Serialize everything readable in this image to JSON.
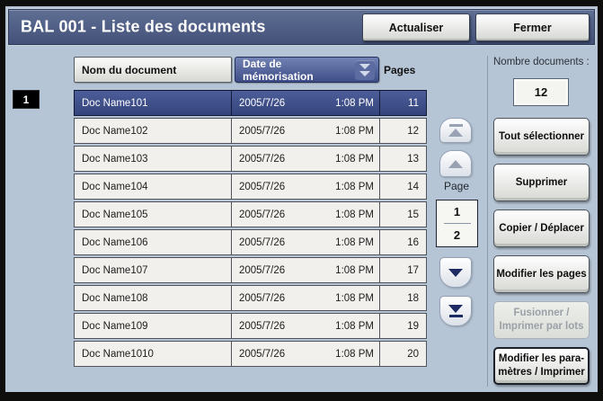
{
  "title_bar": {
    "title": "BAL 001 - Liste des documents",
    "refresh_label": "Actualiser",
    "close_label": "Fermer"
  },
  "table": {
    "columns": {
      "name": "Nom du document",
      "date": "Date de mémorisation",
      "pages": "Pages"
    },
    "sort": {
      "column": "Date de mémorisation",
      "direction": "descending"
    },
    "badge": "1",
    "rows": [
      {
        "name": "Doc Name101",
        "date": "2005/7/26",
        "time": "1:08 PM",
        "pages": "11",
        "selected": true
      },
      {
        "name": "Doc Name102",
        "date": "2005/7/26",
        "time": "1:08 PM",
        "pages": "12",
        "selected": false
      },
      {
        "name": "Doc Name103",
        "date": "2005/7/26",
        "time": "1:08 PM",
        "pages": "13",
        "selected": false
      },
      {
        "name": "Doc Name104",
        "date": "2005/7/26",
        "time": "1:08 PM",
        "pages": "14",
        "selected": false
      },
      {
        "name": "Doc Name105",
        "date": "2005/7/26",
        "time": "1:08 PM",
        "pages": "15",
        "selected": false
      },
      {
        "name": "Doc Name106",
        "date": "2005/7/26",
        "time": "1:08 PM",
        "pages": "16",
        "selected": false
      },
      {
        "name": "Doc Name107",
        "date": "2005/7/26",
        "time": "1:08 PM",
        "pages": "17",
        "selected": false
      },
      {
        "name": "Doc Name108",
        "date": "2005/7/26",
        "time": "1:08 PM",
        "pages": "18",
        "selected": false
      },
      {
        "name": "Doc Name109",
        "date": "2005/7/26",
        "time": "1:08 PM",
        "pages": "19",
        "selected": false
      },
      {
        "name": "Doc Name1010",
        "date": "2005/7/26",
        "time": "1:08 PM",
        "pages": "20",
        "selected": false
      }
    ]
  },
  "pager": {
    "label": "Page",
    "current_page": "1",
    "total_pages": "2"
  },
  "scrollbar": {
    "to_top_enabled": false,
    "up_enabled": false,
    "down_enabled": true,
    "to_bottom_enabled": true
  },
  "counter": {
    "label": "Nombre documents :",
    "value": "12"
  },
  "actions": [
    {
      "label": "Tout sélectionner",
      "label2": "",
      "enabled": true,
      "strong": false
    },
    {
      "label": "Supprimer",
      "label2": "",
      "enabled": true,
      "strong": false
    },
    {
      "label": "Copier / Déplacer",
      "label2": "",
      "enabled": true,
      "strong": false
    },
    {
      "label": "Modifier les pages",
      "label2": "",
      "enabled": true,
      "strong": false
    },
    {
      "label": "Fusionner /",
      "label2": "Imprimer par lots",
      "enabled": false,
      "strong": false
    },
    {
      "label": "Modifier les para-",
      "label2": "mètres / Imprimer",
      "enabled": true,
      "strong": true
    }
  ],
  "icons": {
    "sort_descending": "double-down-triangles",
    "scroll_to_top": "up-triangle-with-bar",
    "scroll_up": "up-triangle",
    "scroll_down": "down-triangle",
    "scroll_to_bottom": "down-triangle-with-bar"
  },
  "colors": {
    "title_bar_bg": "#49587d",
    "screen_bg": "#b6c5d5",
    "selected_row_bg": "#3e4d87",
    "row_bg": "#f1f0ec",
    "sort_header_bg": "#4a5991",
    "badge_bg": "#000000",
    "disabled_text": "#9aa0a6"
  }
}
